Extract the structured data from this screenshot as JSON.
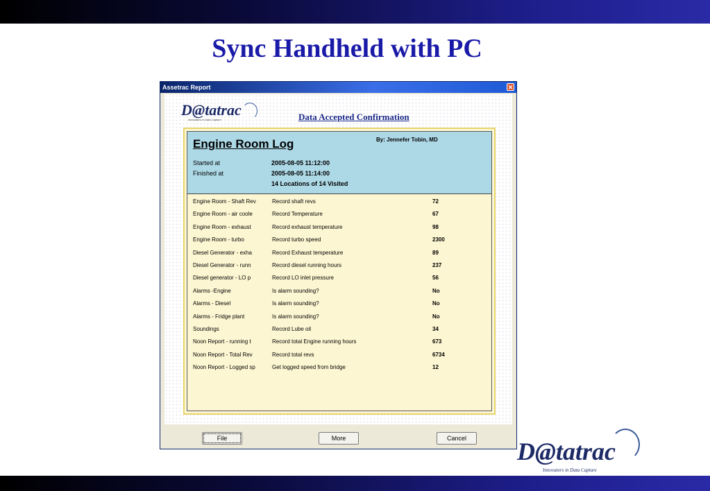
{
  "slide": {
    "title": "Sync Handheld with PC"
  },
  "window": {
    "title": "Assetrac Report",
    "close_glyph": "✕"
  },
  "brand": {
    "logo_text": "D@tatrac",
    "small_tagline": "Innovators in Data Capture",
    "big_tagline": "Innovators in Data Capture"
  },
  "confirmation": "Data Accepted Confirmation",
  "report": {
    "title": "Engine Room Log",
    "by": "By: Jennefer Tobin, MD",
    "started_label": "Started at",
    "started_value": "2005-08-05 11:12:00",
    "finished_label": "Finished at",
    "finished_value": "2005-08-05 11:14:00",
    "visited": "14 Locations of 14 Visited",
    "rows": [
      {
        "location": "Engine Room - Shaft Rev",
        "task": "Record shaft revs",
        "value": "72"
      },
      {
        "location": "Engine Room - air coole",
        "task": "Record Temperature",
        "value": "67"
      },
      {
        "location": "Engine Room - exhaust",
        "task": "Record exhaust temperature",
        "value": "98"
      },
      {
        "location": "Engine Room - turbo",
        "task": "Record turbo speed",
        "value": "2300"
      },
      {
        "location": "Diesel Generator - exha",
        "task": "Record Exhaust temperature",
        "value": "89"
      },
      {
        "location": "Diesel Generator - runn",
        "task": "Record diesel running hours",
        "value": "237"
      },
      {
        "location": "Diesel generator - LO p",
        "task": "Record LO inlet pressure",
        "value": "56"
      },
      {
        "location": "Alarms -Engine",
        "task": "Is alarm sounding?",
        "value": "No"
      },
      {
        "location": "Alarms - Diesel",
        "task": "Is alarm sounding?",
        "value": "No"
      },
      {
        "location": "Alarms - Fridge plant",
        "task": "Is alarm sounding?",
        "value": "No"
      },
      {
        "location": "Soundings",
        "task": "Record Lube oil",
        "value": "34"
      },
      {
        "location": "Noon Report - running t",
        "task": "Record total Engine running hours",
        "value": "673"
      },
      {
        "location": "Noon Report - Total Rev",
        "task": "Record total revs",
        "value": "6734"
      },
      {
        "location": "Noon Report - Logged sp",
        "task": "Get logged speed from bridge",
        "value": "12"
      }
    ]
  },
  "buttons": {
    "file": "File",
    "more": "More",
    "cancel": "Cancel"
  },
  "colors": {
    "title_blue": "#1a1aa8",
    "header_blue": "#add8e6",
    "report_bg": "#fdf6d2",
    "frame_yellow": "#e8d46a"
  }
}
